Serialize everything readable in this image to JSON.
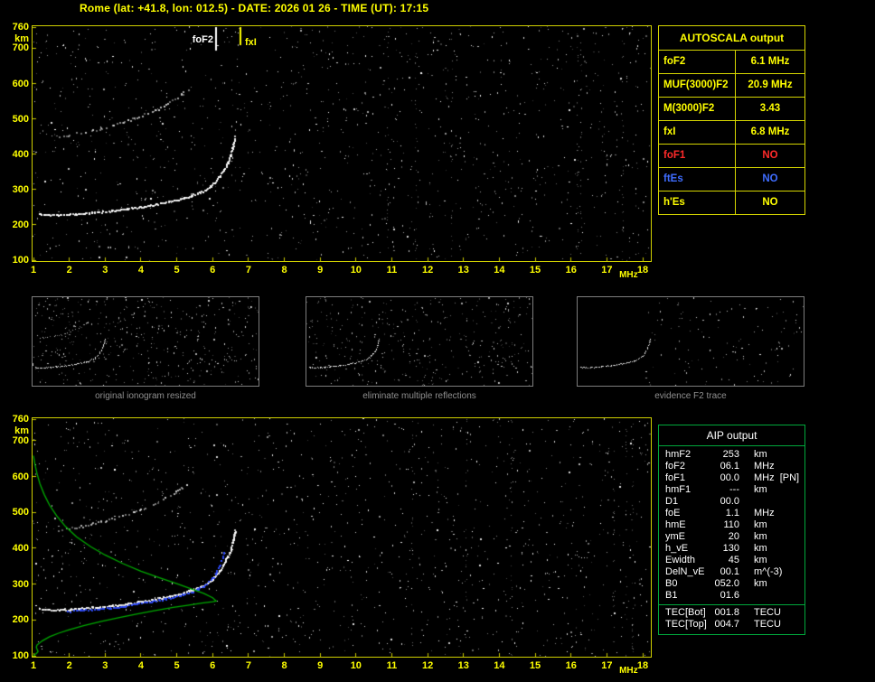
{
  "title": "Rome (lat: +41.8, lon: 012.5) - DATE: 2026 01 26 - TIME (UT): 17:15",
  "colors": {
    "accent_yellow": "#ffff00",
    "value_red": "#ff2a2a",
    "value_blue": "#3f6dff",
    "profile_green": "#00b400",
    "restored_blue": "#2e4bff",
    "aip_border_green": "#00a83c",
    "trace_white": "#ffffff",
    "caption_gray": "#8f8f8f"
  },
  "autoscala_table": {
    "header": "AUTOSCALA output",
    "rows": [
      {
        "label": "foF2",
        "value": "6.1 MHz",
        "color": "yellow"
      },
      {
        "label": "MUF(3000)F2",
        "value": "20.9 MHz",
        "color": "yellow"
      },
      {
        "label": "M(3000)F2",
        "value": "3.43",
        "color": "yellow"
      },
      {
        "label": "fxI",
        "value": "6.8 MHz",
        "color": "yellow"
      },
      {
        "label": "foF1",
        "value": "NO",
        "color": "red"
      },
      {
        "label": "ftEs",
        "value": "NO",
        "color": "blue"
      },
      {
        "label": "h'Es",
        "value": "NO",
        "color": "yellow"
      }
    ]
  },
  "panels": [
    {
      "caption": "original ionogram resized"
    },
    {
      "caption": "eliminate multiple reflections"
    },
    {
      "caption": "evidence F2 trace"
    }
  ],
  "aip_table": {
    "header": "AIP output",
    "rows": [
      {
        "label": "hmF2",
        "value": "253",
        "unit": "km"
      },
      {
        "label": "foF2",
        "value": "06.1",
        "unit": "MHz"
      },
      {
        "label": "foF1",
        "value": "00.0",
        "unit": "MHz  [PN]"
      },
      {
        "label": "hmF1",
        "value": "---",
        "unit": "km"
      },
      {
        "label": "D1",
        "value": "00.0",
        "unit": ""
      },
      {
        "label": "foE",
        "value": "1.1",
        "unit": "MHz"
      },
      {
        "label": "hmE",
        "value": "110",
        "unit": "km"
      },
      {
        "label": "ymE",
        "value": "20",
        "unit": "km"
      },
      {
        "label": "h_vE",
        "value": "130",
        "unit": "km"
      },
      {
        "label": "Ewidth",
        "value": "45",
        "unit": "km"
      },
      {
        "label": "DelN_vE",
        "value": "00.1",
        "unit": "m^(-3)"
      },
      {
        "label": "B0",
        "value": "052.0",
        "unit": "km"
      },
      {
        "label": "B1",
        "value": "01.6",
        "unit": ""
      }
    ],
    "tec_rows": [
      {
        "label": "TEC[Bot]",
        "value": "001.8",
        "unit": "TECU"
      },
      {
        "label": "TEC[Top]",
        "value": "004.7",
        "unit": "TECU"
      }
    ]
  },
  "chart_data": [
    {
      "id": "autoscaled_ionogram",
      "type": "scatter",
      "title": "ionogram with AUTOSCALA frequency markers",
      "xlabel": "MHz",
      "ylabel": "km",
      "xlim": [
        1,
        18
      ],
      "ylim": [
        100,
        760
      ],
      "xticks": [
        1,
        2,
        3,
        4,
        5,
        6,
        7,
        8,
        9,
        10,
        11,
        12,
        13,
        14,
        15,
        16,
        17,
        18
      ],
      "yticks": [
        760,
        700,
        600,
        500,
        400,
        300,
        200,
        100
      ],
      "grid": false,
      "markers": [
        {
          "name": "foF2",
          "x": 6.1,
          "color": "#ffffff"
        },
        {
          "name": "fxI",
          "x": 6.8,
          "color": "#ffff00"
        }
      ],
      "series": [
        {
          "name": "F2 trace",
          "style": "trace",
          "color": "#ffffff",
          "points": [
            [
              1.15,
              232
            ],
            [
              1.4,
              229
            ],
            [
              1.7,
              228
            ],
            [
              2.0,
              230
            ],
            [
              2.4,
              233
            ],
            [
              2.8,
              236
            ],
            [
              3.2,
              240
            ],
            [
              3.6,
              245
            ],
            [
              4.0,
              251
            ],
            [
              4.4,
              258
            ],
            [
              4.8,
              266
            ],
            [
              5.1,
              273
            ],
            [
              5.4,
              282
            ],
            [
              5.7,
              294
            ],
            [
              5.9,
              306
            ],
            [
              6.05,
              320
            ],
            [
              6.2,
              338
            ],
            [
              6.32,
              356
            ],
            [
              6.42,
              376
            ],
            [
              6.5,
              398
            ],
            [
              6.56,
              418
            ],
            [
              6.6,
              436
            ],
            [
              6.62,
              450
            ]
          ]
        },
        {
          "name": "second reflection",
          "style": "sparse",
          "color": "#e0e0e0",
          "points": [
            [
              1.7,
              448
            ],
            [
              2.0,
              455
            ],
            [
              2.3,
              461
            ],
            [
              2.6,
              467
            ],
            [
              2.9,
              474
            ],
            [
              3.2,
              482
            ],
            [
              3.5,
              491
            ],
            [
              3.8,
              501
            ],
            [
              4.1,
              513
            ],
            [
              4.4,
              526
            ],
            [
              4.7,
              541
            ],
            [
              4.95,
              556
            ],
            [
              5.15,
              570
            ],
            [
              5.3,
              583
            ]
          ]
        }
      ]
    },
    {
      "id": "profile_ionogram",
      "type": "scatter",
      "title": "ionogram with restored trace and electron density profile",
      "xlabel": "MHz",
      "ylabel": "km",
      "xlim": [
        1,
        18
      ],
      "ylim": [
        100,
        760
      ],
      "xticks": [
        1,
        2,
        3,
        4,
        5,
        6,
        7,
        8,
        9,
        10,
        11,
        12,
        13,
        14,
        15,
        16,
        17,
        18
      ],
      "yticks": [
        760,
        700,
        600,
        500,
        400,
        300,
        200,
        100
      ],
      "grid": false,
      "markers": [],
      "series": [
        {
          "name": "F2 trace",
          "style": "trace",
          "color": "#ffffff",
          "points": [
            [
              1.15,
              232
            ],
            [
              1.4,
              229
            ],
            [
              1.7,
              228
            ],
            [
              2.0,
              230
            ],
            [
              2.4,
              233
            ],
            [
              2.8,
              236
            ],
            [
              3.2,
              240
            ],
            [
              3.6,
              245
            ],
            [
              4.0,
              251
            ],
            [
              4.4,
              258
            ],
            [
              4.8,
              266
            ],
            [
              5.1,
              273
            ],
            [
              5.4,
              282
            ],
            [
              5.7,
              294
            ],
            [
              5.9,
              306
            ],
            [
              6.05,
              320
            ],
            [
              6.2,
              338
            ],
            [
              6.32,
              356
            ],
            [
              6.42,
              376
            ],
            [
              6.5,
              398
            ],
            [
              6.56,
              418
            ],
            [
              6.6,
              436
            ],
            [
              6.62,
              450
            ]
          ]
        },
        {
          "name": "second reflection",
          "style": "sparse",
          "color": "#e0e0e0",
          "points": [
            [
              1.7,
              448
            ],
            [
              2.0,
              455
            ],
            [
              2.3,
              461
            ],
            [
              2.6,
              467
            ],
            [
              2.9,
              474
            ],
            [
              3.2,
              482
            ],
            [
              3.5,
              491
            ],
            [
              3.8,
              501
            ],
            [
              4.1,
              513
            ],
            [
              4.4,
              526
            ],
            [
              4.7,
              541
            ],
            [
              4.95,
              556
            ],
            [
              5.15,
              570
            ],
            [
              5.3,
              583
            ]
          ]
        },
        {
          "name": "restored trace",
          "style": "dots",
          "color": "#2e4bff",
          "points": [
            [
              1.9,
              229
            ],
            [
              2.3,
              232
            ],
            [
              2.7,
              235
            ],
            [
              3.1,
              239
            ],
            [
              3.5,
              244
            ],
            [
              3.9,
              250
            ],
            [
              4.3,
              257
            ],
            [
              4.7,
              264
            ],
            [
              5.0,
              271
            ],
            [
              5.3,
              280
            ],
            [
              5.6,
              291
            ],
            [
              5.8,
              303
            ],
            [
              5.95,
              317
            ],
            [
              6.08,
              334
            ],
            [
              6.18,
              354
            ],
            [
              6.26,
              378
            ],
            [
              6.32,
              402
            ]
          ]
        },
        {
          "name": "electron density profile",
          "style": "line",
          "color": "#00b400",
          "points": [
            [
              1.0,
              100
            ],
            [
              1.05,
              104
            ],
            [
              1.1,
              108
            ],
            [
              1.13,
              112
            ],
            [
              1.1,
              118
            ],
            [
              1.08,
              124
            ],
            [
              1.1,
              130
            ],
            [
              1.25,
              142
            ],
            [
              1.45,
              153
            ],
            [
              1.7,
              163
            ],
            [
              2.0,
              173
            ],
            [
              2.4,
              184
            ],
            [
              2.9,
              196
            ],
            [
              3.4,
              207
            ],
            [
              3.9,
              217
            ],
            [
              4.4,
              226
            ],
            [
              4.9,
              235
            ],
            [
              5.3,
              241
            ],
            [
              5.7,
              247
            ],
            [
              6.0,
              251
            ],
            [
              6.1,
              253
            ],
            [
              6.0,
              262
            ],
            [
              5.75,
              274
            ],
            [
              5.4,
              287
            ],
            [
              5.0,
              301
            ],
            [
              4.5,
              318
            ],
            [
              4.0,
              336
            ],
            [
              3.5,
              357
            ],
            [
              3.0,
              381
            ],
            [
              2.6,
              404
            ],
            [
              2.2,
              432
            ],
            [
              1.9,
              460
            ],
            [
              1.65,
              490
            ],
            [
              1.45,
              520
            ],
            [
              1.3,
              550
            ],
            [
              1.18,
              580
            ],
            [
              1.1,
              608
            ],
            [
              1.04,
              635
            ],
            [
              1.0,
              658
            ]
          ]
        }
      ]
    }
  ]
}
